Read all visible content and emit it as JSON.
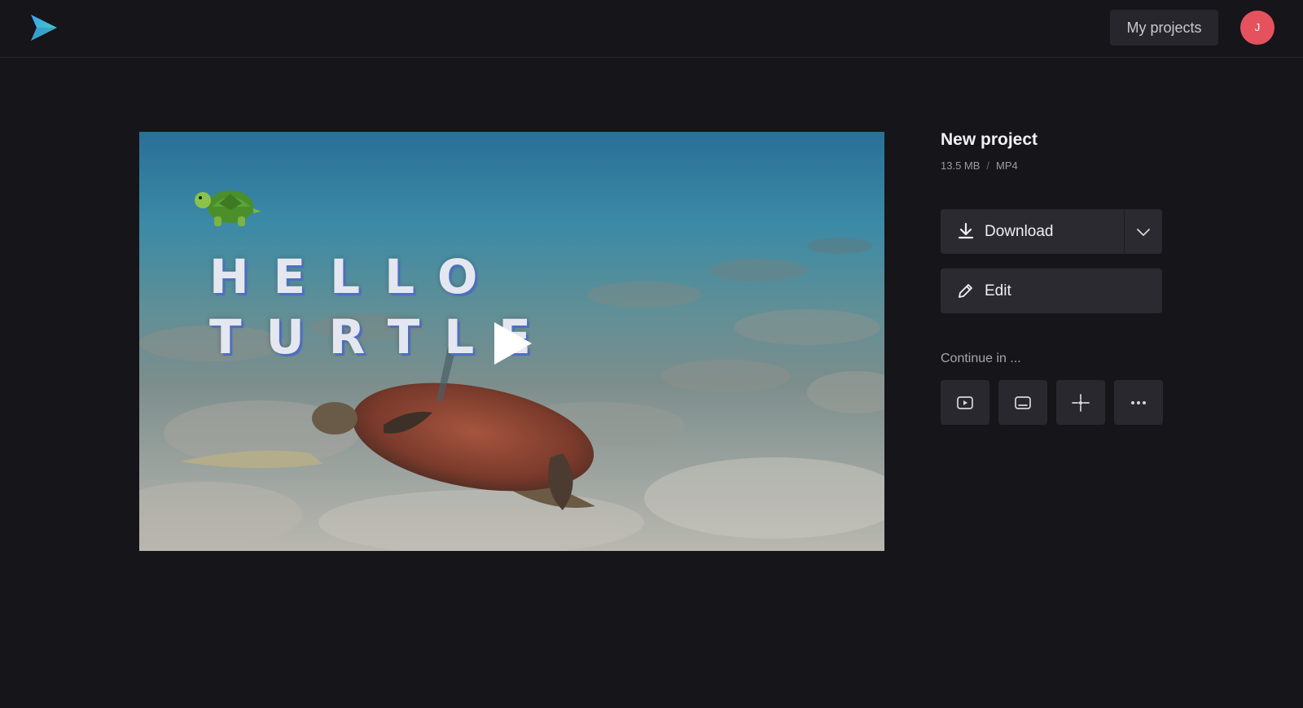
{
  "header": {
    "logo_icon": "play-triangle-logo-icon",
    "my_projects_label": "My projects",
    "avatar_initial": "J",
    "avatar_color": "#e5525e"
  },
  "video": {
    "overlay_emoji": "turtle-emoji",
    "overlay_line1": "HELLO",
    "overlay_line2": "TURTLE",
    "play_icon": "play-icon"
  },
  "project": {
    "title": "New project",
    "size": "13.5 MB",
    "separator": "/",
    "format": "MP4"
  },
  "actions": {
    "download_label": "Download",
    "download_icon": "download-icon",
    "dropdown_icon": "chevron-down-icon",
    "edit_label": "Edit",
    "edit_icon": "pencil-icon"
  },
  "continue_in": {
    "label": "Continue in ...",
    "items": [
      {
        "icon": "video-player-icon"
      },
      {
        "icon": "subtitles-icon"
      },
      {
        "icon": "sparkle-icon"
      },
      {
        "icon": "more-icon"
      }
    ]
  },
  "colors": {
    "background": "#16151a",
    "button": "#2b2a30",
    "accent_logo_start": "#3aa0ff",
    "accent_logo_end": "#4ad6a0"
  }
}
